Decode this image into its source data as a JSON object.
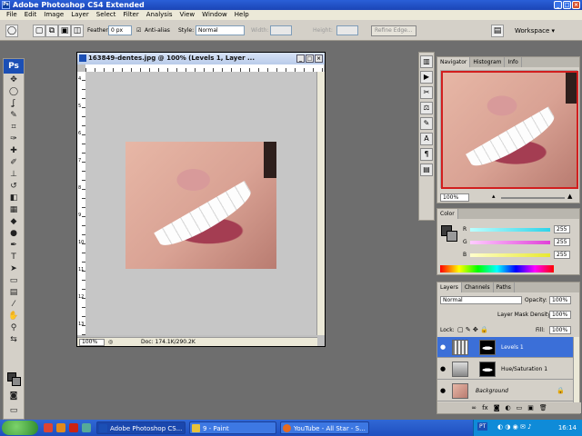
{
  "app": {
    "title": "Adobe Photoshop CS4 Extended"
  },
  "menu": [
    "File",
    "Edit",
    "Image",
    "Layer",
    "Select",
    "Filter",
    "Analysis",
    "View",
    "Window",
    "Help"
  ],
  "options": {
    "feather_label": "Feather:",
    "feather_value": "0 px",
    "antialias_label": "Anti-alias",
    "style_label": "Style:",
    "style_value": "Normal",
    "width_label": "Width:",
    "height_label": "Height:",
    "refine_edge": "Refine Edge...",
    "workspace": "Workspace ▾"
  },
  "document": {
    "title": "163849-dentes.jpg @ 100% (Levels 1, Layer ...",
    "zoom": "100%",
    "doc_size": "Doc: 174.1K/290.2K",
    "ruler_v_marks": [
      "4",
      "5",
      "6",
      "7",
      "8",
      "9",
      "10",
      "11",
      "12",
      "13"
    ]
  },
  "navigator": {
    "tabs": [
      "Navigator",
      "Histogram",
      "Info"
    ],
    "zoom": "100%"
  },
  "color": {
    "tabs": [
      "Color"
    ],
    "r_label": "R",
    "r_value": "255",
    "g_label": "G",
    "g_value": "255",
    "b_label": "B",
    "b_value": "255",
    "colors": {
      "r_bar": "#2ed3e8",
      "g_bar": "#e040d8",
      "b_bar": "#e8e830"
    }
  },
  "layers": {
    "tabs": [
      "Layers",
      "Channels",
      "Paths"
    ],
    "blend_mode": "Normal",
    "opacity_label": "Opacity:",
    "opacity_value": "100%",
    "mask_density_label": "Layer Mask Density",
    "mask_density_value": "100%",
    "lock_label": "Lock:",
    "fill_label": "Fill:",
    "fill_value": "100%",
    "items": [
      {
        "name": "Levels 1",
        "active": true
      },
      {
        "name": "Hue/Saturation 1",
        "active": false
      },
      {
        "name": "Background",
        "active": false
      }
    ]
  },
  "taskbar": {
    "tasks": [
      {
        "label": "Adobe Photoshop CS...",
        "active": true
      },
      {
        "label": "9 - Paint",
        "active": false
      },
      {
        "label": "YouTube - All Star - S...",
        "active": false
      }
    ],
    "lang": "PT",
    "clock": "16:14"
  }
}
